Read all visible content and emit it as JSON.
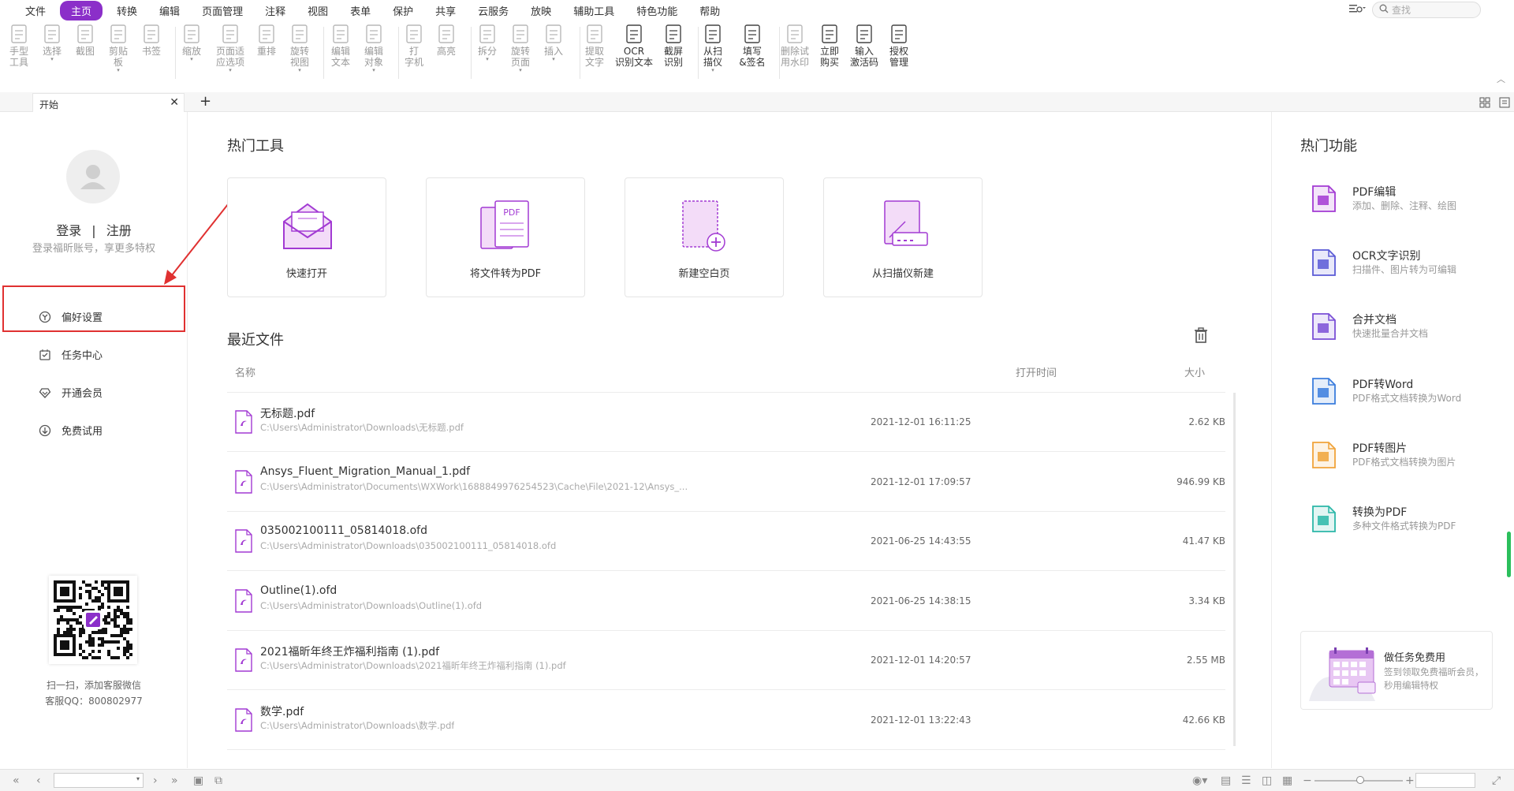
{
  "menu": {
    "items": [
      "文件",
      "主页",
      "转换",
      "编辑",
      "页面管理",
      "注释",
      "视图",
      "表单",
      "保护",
      "共享",
      "云服务",
      "放映",
      "辅助工具",
      "特色功能",
      "帮助"
    ],
    "active_index": 1,
    "search_placeholder": "查找"
  },
  "ribbon": {
    "tools": [
      {
        "label": "手型\n工具",
        "enabled": false,
        "icon": "hand-icon"
      },
      {
        "label": "选择",
        "enabled": false,
        "icon": "select-icon"
      },
      {
        "label": "截图",
        "enabled": false,
        "icon": "snapshot-icon"
      },
      {
        "label": "剪贴\n板",
        "enabled": false,
        "icon": "clipboard-icon"
      },
      {
        "label": "书签",
        "enabled": false,
        "icon": "bookmark-icon"
      },
      {
        "label": "缩放",
        "enabled": false,
        "icon": "zoom-icon"
      },
      {
        "label": "页面适\n应选项",
        "enabled": false,
        "icon": "fit-page-icon"
      },
      {
        "label": "重排",
        "enabled": false,
        "icon": "reflow-icon"
      },
      {
        "label": "旋转\n视图",
        "enabled": false,
        "icon": "rotate-view-icon"
      },
      {
        "label": "编辑\n文本",
        "enabled": false,
        "icon": "edit-text-icon"
      },
      {
        "label": "编辑\n对象",
        "enabled": false,
        "icon": "edit-object-icon"
      },
      {
        "label": "打\n字机",
        "enabled": false,
        "icon": "typewriter-icon"
      },
      {
        "label": "高亮",
        "enabled": false,
        "icon": "highlight-icon"
      },
      {
        "label": "拆分",
        "enabled": false,
        "icon": "split-icon"
      },
      {
        "label": "旋转\n页面",
        "enabled": false,
        "icon": "rotate-page-icon"
      },
      {
        "label": "插入",
        "enabled": false,
        "icon": "insert-icon"
      },
      {
        "label": "提取\n文字",
        "enabled": false,
        "icon": "extract-text-icon"
      },
      {
        "label": "OCR\n识别文本",
        "enabled": true,
        "icon": "ocr-icon"
      },
      {
        "label": "截屏\n识别",
        "enabled": true,
        "icon": "screen-ocr-icon"
      },
      {
        "label": "从扫\n描仪",
        "enabled": true,
        "icon": "scanner-icon"
      },
      {
        "label": "填写\n&签名",
        "enabled": true,
        "icon": "sign-icon"
      },
      {
        "label": "删除试\n用水印",
        "enabled": false,
        "icon": "remove-watermark-icon"
      },
      {
        "label": "立即\n购买",
        "enabled": true,
        "icon": "cart-icon"
      },
      {
        "label": "输入\n激活码",
        "enabled": true,
        "icon": "activation-icon"
      },
      {
        "label": "授权\n管理",
        "enabled": true,
        "icon": "license-icon"
      }
    ]
  },
  "tabs": {
    "doc_tab": "开始",
    "new_tab": "+"
  },
  "left": {
    "login": "登录",
    "separator": "|",
    "register": "注册",
    "login_sub": "登录福昕账号，享更多特权",
    "nav": [
      {
        "label": "偏好设置",
        "icon": "preferences-icon"
      },
      {
        "label": "任务中心",
        "icon": "task-center-icon"
      },
      {
        "label": "开通会员",
        "icon": "membership-icon"
      },
      {
        "label": "免费试用",
        "icon": "free-trial-icon"
      }
    ],
    "qr_caption_1": "扫一扫，添加客服微信",
    "qr_caption_2": "客服QQ：800802977"
  },
  "main": {
    "hot_tools_title": "热门工具",
    "tools": [
      {
        "label": "快速打开",
        "icon": "quick-open-icon"
      },
      {
        "label": "将文件转为PDF",
        "icon": "convert-to-pdf-icon"
      },
      {
        "label": "新建空白页",
        "icon": "new-blank-page-icon"
      },
      {
        "label": "从扫描仪新建",
        "icon": "scanner-new-icon"
      }
    ],
    "recent_title": "最近文件",
    "col_name": "名称",
    "col_time": "打开时间",
    "col_size": "大小",
    "files": [
      {
        "name": "无标题.pdf",
        "path": "C:\\Users\\Administrator\\Downloads\\无标题.pdf",
        "time": "2021-12-01 16:11:25",
        "size": "2.62 KB"
      },
      {
        "name": "Ansys_Fluent_Migration_Manual_1.pdf",
        "path": "C:\\Users\\Administrator\\Documents\\WXWork\\1688849976254523\\Cache\\File\\2021-12\\Ansys_...",
        "time": "2021-12-01 17:09:57",
        "size": "946.99 KB"
      },
      {
        "name": "035002100111_05814018.ofd",
        "path": "C:\\Users\\Administrator\\Downloads\\035002100111_05814018.ofd",
        "time": "2021-06-25 14:43:55",
        "size": "41.47 KB"
      },
      {
        "name": "Outline(1).ofd",
        "path": "C:\\Users\\Administrator\\Downloads\\Outline(1).ofd",
        "time": "2021-06-25 14:38:15",
        "size": "3.34 KB"
      },
      {
        "name": "2021福昕年终王炸福利指南 (1).pdf",
        "path": "C:\\Users\\Administrator\\Downloads\\2021福昕年终王炸福利指南 (1).pdf",
        "time": "2021-12-01 14:20:57",
        "size": "2.55 MB"
      },
      {
        "name": "数学.pdf",
        "path": "C:\\Users\\Administrator\\Downloads\\数学.pdf",
        "time": "2021-12-01 13:22:43",
        "size": "42.66 KB"
      }
    ]
  },
  "right": {
    "title": "热门功能",
    "features": [
      {
        "title": "PDF编辑",
        "sub": "添加、删除、注释、绘图",
        "icon": "pdf-edit-icon",
        "color": "#a23ad3"
      },
      {
        "title": "OCR文字识别",
        "sub": "扫描件、图片转为可编辑",
        "icon": "ocr-text-icon",
        "color": "#5b5bd6"
      },
      {
        "title": "合并文档",
        "sub": "快速批量合并文档",
        "icon": "merge-docs-icon",
        "color": "#7a4fd6"
      },
      {
        "title": "PDF转Word",
        "sub": "PDF格式文档转换为Word",
        "icon": "pdf-to-word-icon",
        "color": "#3b7ddd"
      },
      {
        "title": "PDF转图片",
        "sub": "PDF格式文档转换为图片",
        "icon": "pdf-to-image-icon",
        "color": "#f0a33a"
      },
      {
        "title": "转换为PDF",
        "sub": "多种文件格式转换为PDF",
        "icon": "convert-pdf-icon",
        "color": "#2bb7a8"
      }
    ],
    "promo_title": "做任务免费用",
    "promo_sub": "签到领取免费福昕会员，秒用编辑特权"
  },
  "colors": {
    "brand": "#8b2fc9",
    "highlight_border": "#e03131",
    "scroll_accent": "#2bbf5c"
  }
}
